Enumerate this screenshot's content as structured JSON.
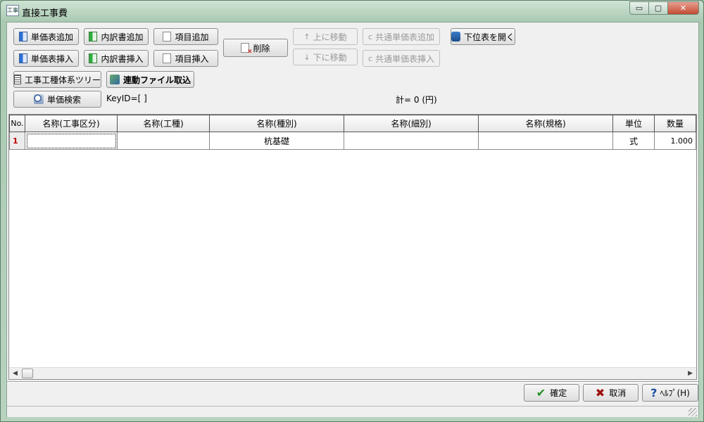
{
  "window": {
    "icon_text": "工事",
    "title": "直接工事費",
    "minimize": "▭",
    "restore": "▢",
    "close": "✕"
  },
  "toolbar": {
    "add_price_table": "単価表追加",
    "add_breakdown": "内訳書追加",
    "add_item": "項目追加",
    "insert_price_table": "単価表挿入",
    "insert_breakdown": "内訳書挿入",
    "insert_item": "項目挿入",
    "delete": "削除",
    "move_up": "上に移動",
    "move_down": "下に移動",
    "add_common_price": "共通単価表追加",
    "insert_common_price": "共通単価表挿入",
    "open_lower_table": "下位表を開く",
    "work_tree": "工事工種体系ツリー",
    "import_linked_file": "連動ファイル取込",
    "price_search": "単価検索"
  },
  "info": {
    "key_id": "KeyID=[ ]",
    "total": "計= 0 (円)"
  },
  "grid": {
    "columns": [
      "No.",
      "名称(工事区分)",
      "名称(工種)",
      "名称(種別)",
      "名称(細別)",
      "名称(規格)",
      "単位",
      "数量"
    ],
    "rows": [
      [
        "1",
        "",
        "",
        "杭基礎",
        "",
        "",
        "式",
        "1.000"
      ]
    ]
  },
  "footer": {
    "confirm": "確定",
    "cancel": "取消",
    "help": "ﾍﾙﾌﾟ(H)"
  },
  "icons": {
    "confirm": "checkmark-icon",
    "cancel": "x-icon",
    "help": "question-icon"
  },
  "colors": {
    "row_number": "#c00000",
    "window_frame": "#a9c9b1",
    "close_button": "#c24a32"
  }
}
